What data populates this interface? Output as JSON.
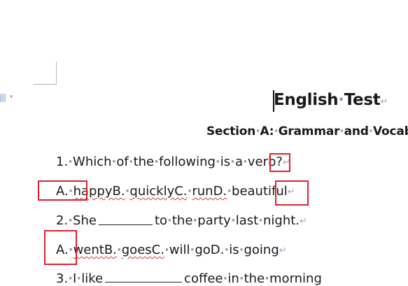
{
  "document": {
    "title_words": [
      "English",
      "Test"
    ],
    "section_words": [
      "Section",
      "A:",
      "Grammar",
      "and",
      "Vocabu"
    ],
    "q1_words": [
      "1.",
      "Which",
      "of",
      "the",
      "following",
      "is",
      "a",
      "verb?"
    ],
    "a1_words": [
      "A.",
      "happyB.",
      "quicklyC.",
      "runD.",
      "beautiful"
    ],
    "q2_before": [
      "2.",
      "She"
    ],
    "q2_after": [
      "to",
      "the",
      "party",
      "last",
      "night."
    ],
    "a2_words": [
      "A.",
      "wentB.",
      "goesC.",
      "will",
      "goD.",
      "is",
      "going"
    ],
    "q3_before": [
      "3.",
      "I",
      "like"
    ],
    "q3_after": [
      "coffee",
      "in",
      "the",
      "morning"
    ]
  },
  "colors": {
    "highlight_box": "#e02030",
    "formatting_marks": "#9aa6cf",
    "spell_underline": "#d23a3a"
  },
  "icons": {
    "side": "document-icon",
    "caret": "chevron-down-icon",
    "paragraph_mark": "↵"
  }
}
